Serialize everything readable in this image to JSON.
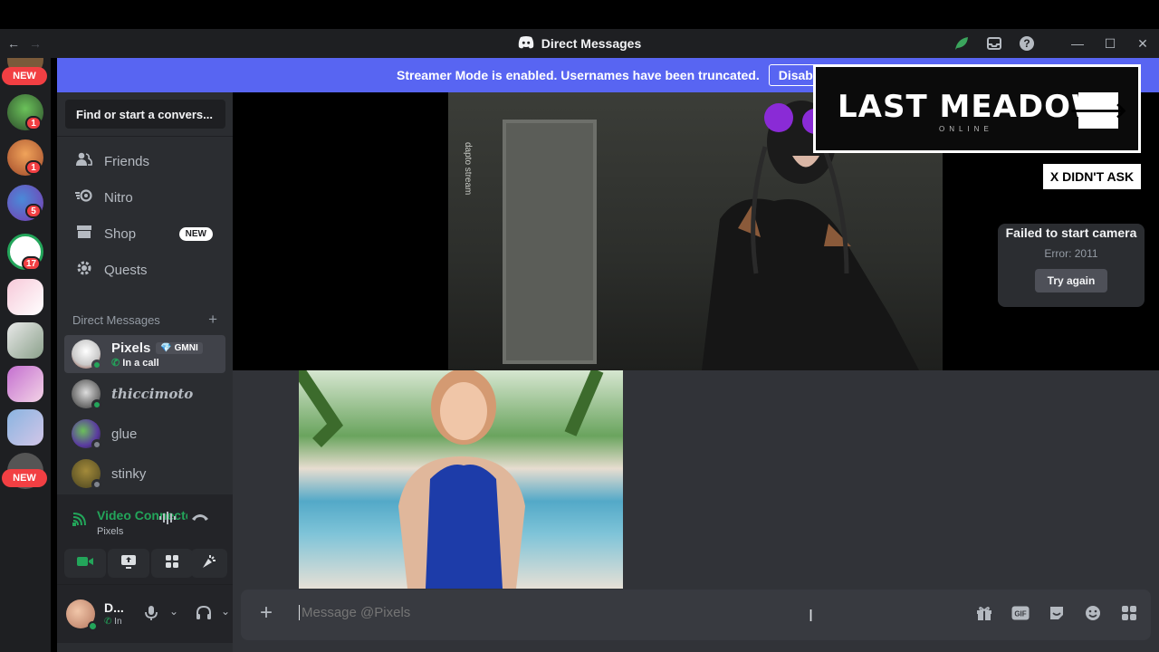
{
  "window": {
    "title": "Direct Messages",
    "back_icon": "←",
    "forward_icon": "→"
  },
  "banner": {
    "text": "Streamer Mode is enabled. Usernames have been truncated.",
    "button": "Disable"
  },
  "rail": {
    "new_top": "NEW",
    "new_bottom": "NEW",
    "badges": [
      "1",
      "1",
      "5",
      "17"
    ]
  },
  "sidebar": {
    "search_placeholder": "Find or start a convers...",
    "nav": [
      {
        "label": "Friends",
        "icon": "friends-icon"
      },
      {
        "label": "Nitro",
        "icon": "nitro-icon"
      },
      {
        "label": "Shop",
        "icon": "shop-icon",
        "tag": "NEW"
      },
      {
        "label": "Quests",
        "icon": "quests-icon"
      }
    ],
    "dm_header": "Direct Messages",
    "dms": [
      {
        "name": "Pixels",
        "tag": "GMNI",
        "sub": "In a call",
        "status": "online"
      },
      {
        "name": "thiccimoto",
        "status": "online"
      },
      {
        "name": "glue",
        "status": "offline"
      },
      {
        "name": "stinky",
        "status": "offline"
      }
    ]
  },
  "voice": {
    "status": "Video Connected",
    "channel": "Pixels"
  },
  "user": {
    "name": "D...",
    "status": "In"
  },
  "stage": {
    "stream_label": "dapto stream",
    "camera_error": {
      "title": "Failed to start camera",
      "error": "Error: 2011",
      "button": "Try again"
    }
  },
  "overlay": {
    "ad_title": "LAST MEADOW",
    "ad_subtitle": "ONLINE",
    "ad_button": "🡒",
    "dismiss": "X DIDN'T ASK"
  },
  "composer": {
    "placeholder": "Message @Pixels"
  },
  "colors": {
    "accent": "#5865f2",
    "online": "#23a55a",
    "danger": "#f23f43"
  }
}
